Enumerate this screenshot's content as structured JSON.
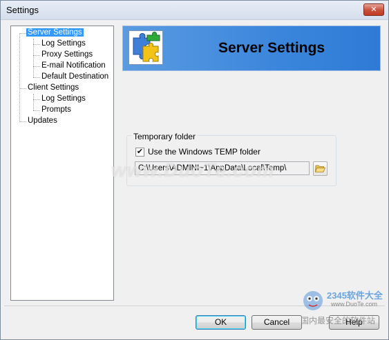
{
  "window": {
    "title": "Settings",
    "close_glyph": "✕"
  },
  "tree": {
    "items": [
      {
        "label": "Server Settings",
        "level": 0,
        "selected": true
      },
      {
        "label": "Log Settings",
        "level": 1
      },
      {
        "label": "Proxy Settings",
        "level": 1
      },
      {
        "label": "E-mail Notification",
        "level": 1
      },
      {
        "label": "Default Destination",
        "level": 1
      },
      {
        "label": "Client Settings",
        "level": 0
      },
      {
        "label": "Log Settings",
        "level": 1
      },
      {
        "label": "Prompts",
        "level": 1
      },
      {
        "label": "Updates",
        "level": 0
      }
    ]
  },
  "header": {
    "title": "Server Settings",
    "icon": "puzzle-pieces-icon"
  },
  "temp_group": {
    "label": "Temporary folder",
    "checkbox_label": "Use the Windows TEMP folder",
    "checked": true,
    "check_glyph": "✔",
    "path_value": "C:\\Users\\ADMINI~1\\AppData\\Local\\Temp\\",
    "browse_icon": "folder-open-icon"
  },
  "buttons": {
    "ok": "OK",
    "cancel": "Cancel",
    "help": "Help"
  },
  "watermarks": {
    "center": "www.DuoTe.com",
    "corner_brand": "2345软件大全",
    "corner_url": "www.DuoTe.com",
    "corner_slogan": "国内最安全的软件站"
  },
  "colors": {
    "selection": "#3399ff",
    "banner": "#3b86dc"
  }
}
